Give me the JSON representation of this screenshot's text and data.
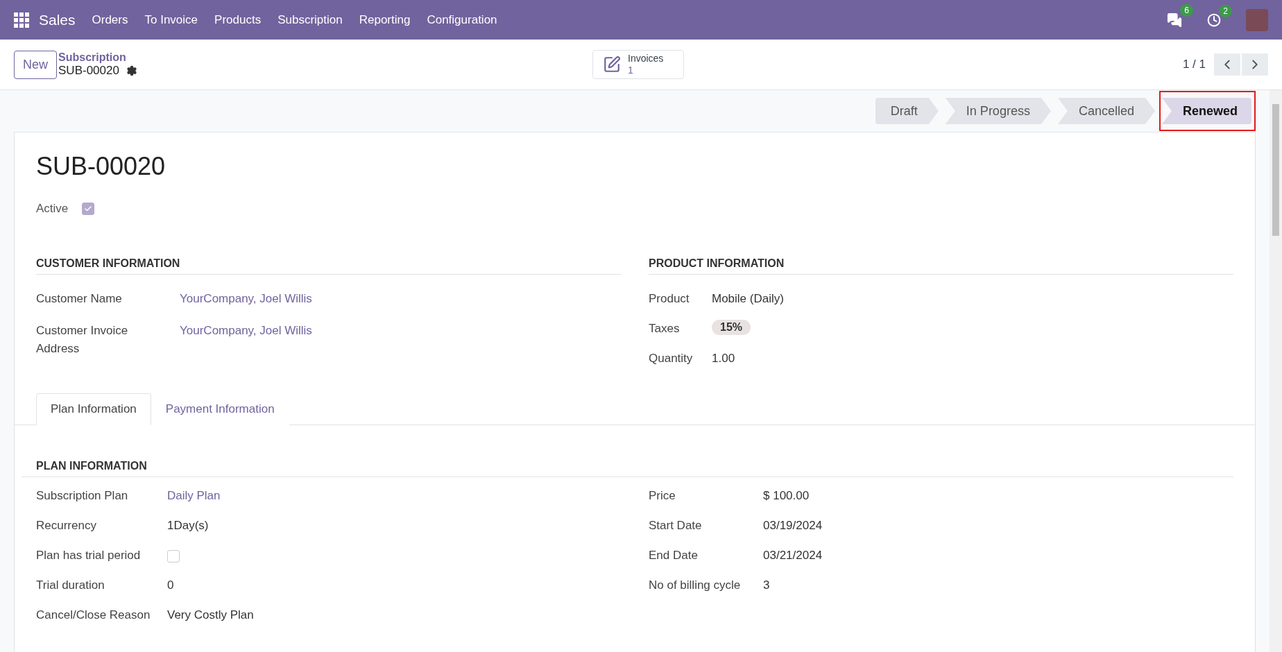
{
  "navbar": {
    "app": "Sales",
    "menu": [
      "Orders",
      "To Invoice",
      "Products",
      "Subscription",
      "Reporting",
      "Configuration"
    ],
    "messages_badge": "6",
    "activities_badge": "2"
  },
  "control_panel": {
    "new_button": "New",
    "breadcrumb": "Subscription",
    "record": "SUB-00020",
    "smart_button": {
      "label": "Invoices",
      "count": "1"
    },
    "pager": "1 / 1"
  },
  "stages": [
    {
      "label": "Draft",
      "selected": false,
      "highlighted": false
    },
    {
      "label": "In Progress",
      "selected": false,
      "highlighted": false
    },
    {
      "label": "Cancelled",
      "selected": false,
      "highlighted": false
    },
    {
      "label": "Renewed",
      "selected": true,
      "highlighted": true
    }
  ],
  "form": {
    "title": "SUB-00020",
    "active": {
      "label": "Active",
      "checked": true
    },
    "customer_section": {
      "title": "CUSTOMER INFORMATION",
      "fields": [
        {
          "label": "Customer Name",
          "value": "YourCompany, Joel Willis",
          "kind": "link"
        },
        {
          "label": "Customer Invoice Address",
          "value": "YourCompany, Joel Willis",
          "kind": "link"
        }
      ]
    },
    "product_section": {
      "title": "PRODUCT INFORMATION",
      "fields": [
        {
          "label": "Product",
          "value": "Mobile (Daily)",
          "kind": "text"
        },
        {
          "label": "Taxes",
          "value": "15%",
          "kind": "tag"
        },
        {
          "label": "Quantity",
          "value": "1.00",
          "kind": "text"
        }
      ]
    },
    "tabs": [
      {
        "label": "Plan Information",
        "selected": true
      },
      {
        "label": "Payment Information",
        "selected": false
      }
    ],
    "plan_section": {
      "title": "PLAN INFORMATION",
      "left": [
        {
          "label": "Subscription Plan",
          "value": "Daily Plan",
          "kind": "link"
        },
        {
          "label": "Recurrency",
          "value": "1Day(s)",
          "kind": "text"
        },
        {
          "label": "Plan has trial period",
          "kind": "checkbox",
          "checked": false
        },
        {
          "label": "Trial duration",
          "value": "0",
          "kind": "text"
        },
        {
          "label": "Cancel/Close Reason",
          "value": "Very Costly Plan",
          "kind": "text"
        }
      ],
      "right": [
        {
          "label": "Price",
          "value": "$ 100.00",
          "kind": "text"
        },
        {
          "label": "Start Date",
          "value": "03/19/2024",
          "kind": "text"
        },
        {
          "label": "End Date",
          "value": "03/21/2024",
          "kind": "text"
        },
        {
          "label": "No of billing cycle",
          "value": "3",
          "kind": "text"
        }
      ]
    }
  }
}
